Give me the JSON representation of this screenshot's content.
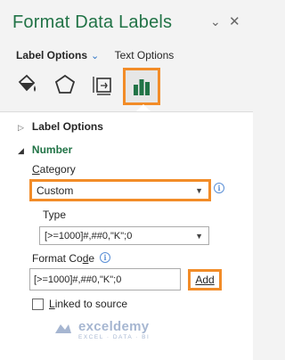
{
  "header": {
    "title": "Format Data Labels"
  },
  "tabs": {
    "label_options": "Label Options",
    "text_options": "Text Options"
  },
  "icons": [
    "paint-bucket-icon",
    "pentagon-icon",
    "size-properties-icon",
    "bar-chart-icon"
  ],
  "sections": {
    "label_options": "Label Options",
    "number": "Number"
  },
  "category": {
    "label": "Category",
    "value": "Custom"
  },
  "type": {
    "label": "Type",
    "value": "[>=1000]#,##0,\"K\";0"
  },
  "format_code": {
    "label": "Format Code",
    "value": "[>=1000]#,##0,\"K\";0",
    "add_label": "Add"
  },
  "linked_to_source": {
    "label": "Linked to source",
    "checked": false
  },
  "watermark": {
    "name": "exceldemy",
    "tagline": "EXCEL · DATA · BI"
  },
  "colors": {
    "accent": "#217346",
    "highlight": "#f28c28",
    "link": "#2b72c6"
  }
}
